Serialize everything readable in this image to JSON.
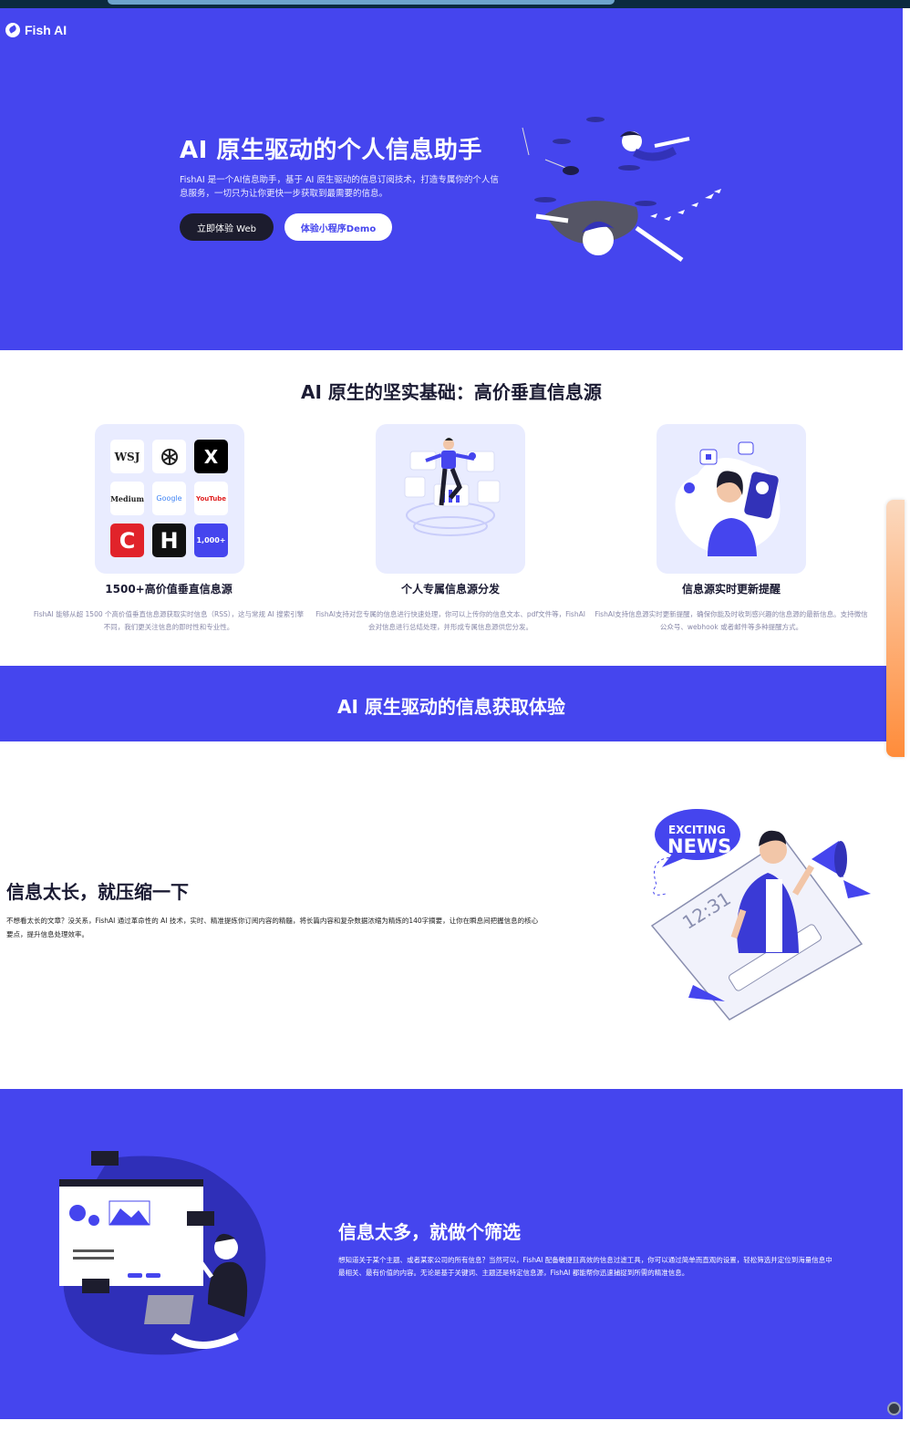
{
  "brand": {
    "name": "Fish AI"
  },
  "hero": {
    "title": "AI 原生驱动的个人信息助手",
    "description": "FishAI 是一个AI信息助手，基于 AI 原生驱动的信息订阅技术，打造专属你的个人信息服务，一切只为让你更快一步获取到最需要的信息。",
    "primary_button": "立即体验 Web",
    "secondary_button": "体验小程序Demo"
  },
  "features_section": {
    "title": "AI 原生的坚实基础：高价垂直信息源",
    "items": [
      {
        "title": "1500+高价值垂直信息源",
        "description": "FishAI 能够从超 1500 个高价值垂直信息源获取实时信息（RSS），这与常规 AI 搜索引擎不同，我们更关注信息的即时性和专业性。",
        "tiles": [
          "WSJ",
          "openai",
          "X",
          "Medium",
          "Google",
          "YouTube",
          "C",
          "H",
          "1,000+"
        ]
      },
      {
        "title": "个人专属信息源分发",
        "description": "FishAI支持对您专属的信息进行快速处理，你可以上传你的信息文本、pdf文件等，FishAI 会对信息进行总结处理，并形成专属信息源供您分发。"
      },
      {
        "title": "信息源实时更新提醒",
        "description": "FishAI支持信息源实时更新提醒，确保你能及时收到感兴趣的信息源的最新信息。支持微信公众号、webhook 或者邮件等多种提醒方式。"
      }
    ]
  },
  "experience_band": {
    "title": "AI 原生驱动的信息获取体验"
  },
  "feature_compress": {
    "title": "信息太长，就压缩一下",
    "description": "不想看太长的文章？没关系，FishAI 通过革命性的 AI 技术，实时、精准提炼你订阅内容的精髓，将长篇内容和复杂数据浓缩为精炼的140字摘要，让你在瞬息间把握信息的核心要点，提升信息处理效率。",
    "art_badge_line1": "EXCITING",
    "art_badge_line2": "NEWS",
    "art_clock": "12:31"
  },
  "feature_filter": {
    "title": "信息太多，就做个筛选",
    "description": "想知道关于某个主题、或者某家公司的所有信息？当然可以，FishAI 配备敏捷且高效的信息过滤工具，你可以通过简单而直观的设置，轻松筛选并定位到海量信息中最相关、最有价值的内容。无论是基于关键词、主题还是特定信息源，FishAI 都能帮你迅速捕捉到所需的精准信息。"
  },
  "colors": {
    "brand_blue": "#4545ee",
    "dark_text": "#1b1b33",
    "accent_orange": "#ff8c3a"
  }
}
